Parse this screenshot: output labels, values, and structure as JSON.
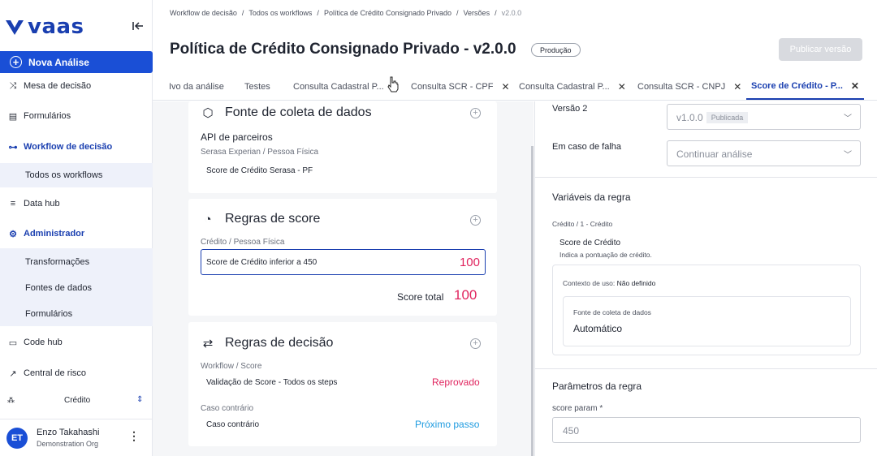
{
  "app": {
    "logo_text": "vaas"
  },
  "sidebar": {
    "new_button": "Nova Análise",
    "items": [
      {
        "label": "Mesa de decisão",
        "icon": "shuffle-icon"
      },
      {
        "label": "Formulários",
        "icon": "form-icon"
      },
      {
        "label": "Workflow de decisão",
        "icon": "workflow-icon"
      },
      {
        "label": "Data hub",
        "icon": "database-icon"
      },
      {
        "label": "Administrador",
        "icon": "admin-icon"
      },
      {
        "label": "Code hub",
        "icon": "code-icon"
      },
      {
        "label": "Central de risco",
        "icon": "chart-icon"
      }
    ],
    "workflow_sub": [
      "Todos os workflows"
    ],
    "admin_sub": [
      "Transformações",
      "Fontes de dados",
      "Formulários"
    ],
    "org_selector": "Crédito",
    "user": {
      "initials": "ET",
      "name": "Enzo Takahashi",
      "org": "Demonstration Org"
    }
  },
  "breadcrumb": [
    "Workflow de decisão",
    "Todos os workflows",
    "Política de Crédito Consignado Privado",
    "Versões",
    "v2.0.0"
  ],
  "header": {
    "title": "Política de Crédito Consignado Privado - v2.0.0",
    "badge": "Produção",
    "publish_button": "Publicar versão"
  },
  "tabs": [
    {
      "label": "Ivo da análise",
      "closable": false
    },
    {
      "label": "Testes",
      "closable": false
    },
    {
      "label": "Consulta Cadastral P...",
      "closable": true
    },
    {
      "label": "Consulta SCR - CPF",
      "closable": true
    },
    {
      "label": "Consulta Cadastral P...",
      "closable": true
    },
    {
      "label": "Consulta SCR - CNPJ",
      "closable": true
    },
    {
      "label": "Score de Crédito - P...",
      "closable": true,
      "active": true
    }
  ],
  "cards": {
    "fonte": {
      "title": "Fonte de coleta de dados",
      "type": "API de parceiros",
      "provider": "Serasa Experian / Pessoa Física",
      "item": "Score de Crédito Serasa - PF"
    },
    "score": {
      "title": "Regras de score",
      "category": "Crédito / Pessoa Física",
      "rule_label": "Score de Crédito inferior a 450",
      "rule_value": "100",
      "total_label": "Score total",
      "total_value": "100"
    },
    "decisao": {
      "title": "Regras de decisão",
      "group1": "Workflow / Score",
      "rule1_label": "Validação de Score - Todos os steps",
      "rule1_result": "Reprovado",
      "group2": "Caso contrário",
      "rule2_label": "Caso contrário",
      "rule2_result": "Próximo passo"
    }
  },
  "right_panel": {
    "version_label": "Versão 2",
    "version_value": "v1.0.0",
    "version_tag": "Publicada",
    "failure_label": "Em caso de falha",
    "failure_value": "Continuar análise",
    "vars_title": "Variáveis da regra",
    "vars_path": "Crédito / 1 - Crédito",
    "var_name": "Score de Crédito",
    "var_desc": "Indica a pontuação de crédito.",
    "context_label": "Contexto de uso:",
    "context_value": "Não definido",
    "source_label": "Fonte de coleta de dados",
    "source_value": "Automático",
    "params_title": "Parâmetros da regra",
    "param_label": "score param *",
    "param_value": "450"
  },
  "colors": {
    "brand": "#1a4fd6",
    "accent_pink": "#e0245e",
    "accent_blue": "#1e9be0"
  }
}
